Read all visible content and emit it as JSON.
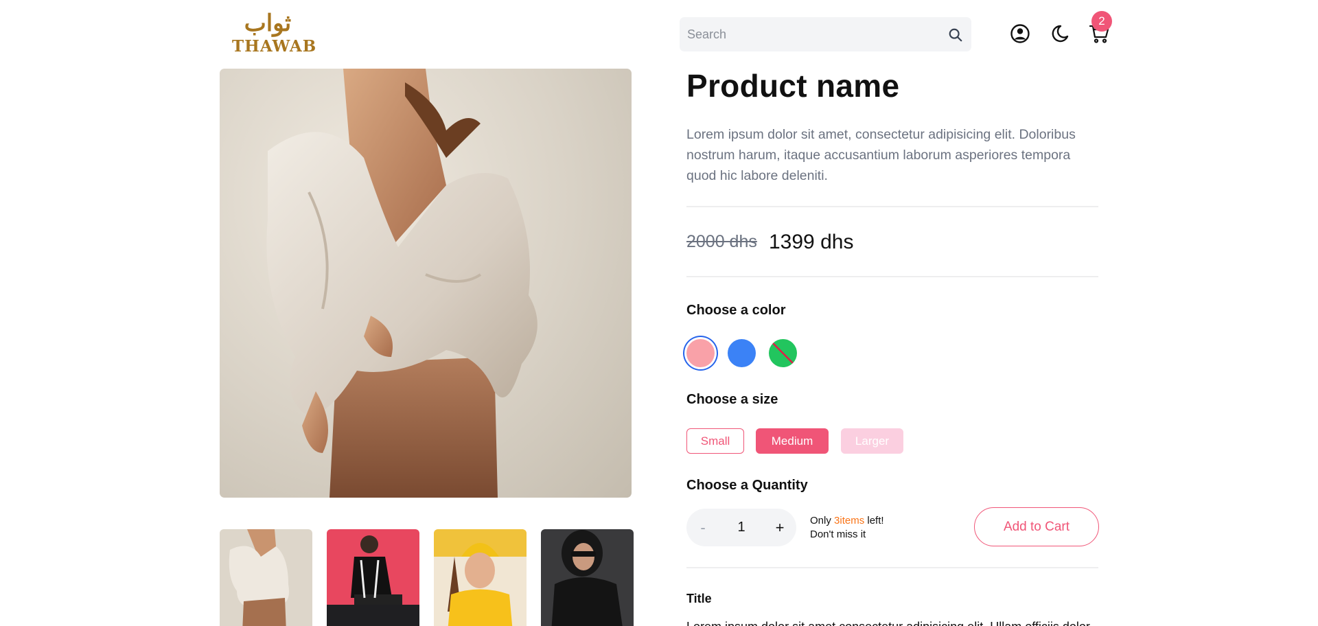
{
  "header": {
    "logo_arabic": "ثواب",
    "logo_text": "THAWAB",
    "search_placeholder": "Search",
    "search_value": "",
    "cart_count": "2",
    "icons": [
      "user-circle-icon",
      "moon-icon",
      "cart-icon",
      "search-icon"
    ]
  },
  "gallery": {
    "thumbnails": [
      "beige-shirt-model",
      "red-backdrop-model",
      "yellow-beanie-model",
      "dark-coat-model"
    ]
  },
  "product": {
    "name": "Product name",
    "description": "Lorem ipsum dolor sit amet, consectetur adipisicing elit. Doloribus nostrum harum, itaque accusantium laborum asperiores tempora quod hic labore deleniti.",
    "old_price": "2000 dhs",
    "price": "1399 dhs"
  },
  "color": {
    "label": "Choose a color",
    "options": [
      {
        "name": "pink",
        "hex": "#f9a1a8",
        "selected": true,
        "available": true
      },
      {
        "name": "blue",
        "hex": "#3b82f6",
        "selected": false,
        "available": true
      },
      {
        "name": "green",
        "hex": "#22c55e",
        "selected": false,
        "available": false
      }
    ]
  },
  "size": {
    "label": "Choose a size",
    "options": [
      {
        "label": "Small",
        "state": "default"
      },
      {
        "label": "Medium",
        "state": "selected"
      },
      {
        "label": "Larger",
        "state": "disabled"
      }
    ]
  },
  "quantity": {
    "label": "Choose a Quantity",
    "minus": "-",
    "value": "1",
    "plus": "+",
    "stock_prefix": "Only ",
    "stock_count": "3items",
    "stock_suffix": " left!",
    "stock_note": "Don't miss it"
  },
  "add_to_cart": "Add to Cart",
  "details": {
    "title": "Title",
    "text": "Lorem ipsum dolor sit amet consectetur adipisicing elit. Ullam officiis dolor"
  },
  "colors": {
    "accent": "#f05577",
    "highlight": "#f97316",
    "muted_text": "#6b7280",
    "input_bg": "#f3f4f6",
    "logo_gold": "#a8761f"
  }
}
